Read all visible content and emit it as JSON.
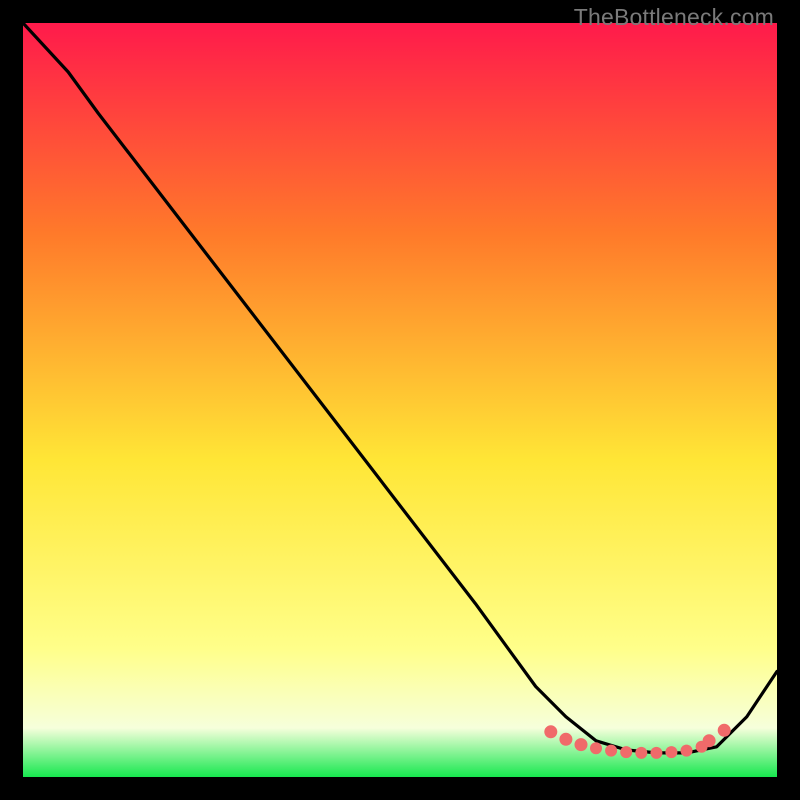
{
  "watermark": "TheBottleneck.com",
  "colors": {
    "gradient_top": "#ff1a4b",
    "gradient_mid_upper": "#ff7a2a",
    "gradient_mid": "#ffe636",
    "gradient_lower": "#ffff8a",
    "gradient_band": "#f6ffdb",
    "gradient_bottom": "#17e84f",
    "curve": "#000000",
    "marker": "#f06a6a"
  },
  "chart_data": {
    "type": "line",
    "title": "",
    "xlabel": "",
    "ylabel": "",
    "xlim": [
      0,
      100
    ],
    "ylim": [
      0,
      100
    ],
    "grid": false,
    "legend": false,
    "series": [
      {
        "name": "bottleneck-curve",
        "x": [
          0,
          6,
          10,
          20,
          30,
          40,
          50,
          60,
          68,
          72,
          76,
          80,
          84,
          88,
          92,
          96,
          100
        ],
        "y": [
          100,
          93.5,
          88,
          75,
          62,
          49,
          36,
          23,
          12,
          8,
          4.8,
          3.6,
          3.2,
          3.2,
          4.0,
          8,
          14
        ]
      }
    ],
    "markers": {
      "name": "highlight-dots",
      "x": [
        70,
        72,
        74,
        76,
        78,
        80,
        82,
        84,
        86,
        88,
        90,
        91,
        93
      ],
      "y": [
        6.0,
        5.0,
        4.3,
        3.8,
        3.5,
        3.3,
        3.2,
        3.2,
        3.3,
        3.5,
        4.0,
        4.8,
        6.2
      ]
    }
  }
}
